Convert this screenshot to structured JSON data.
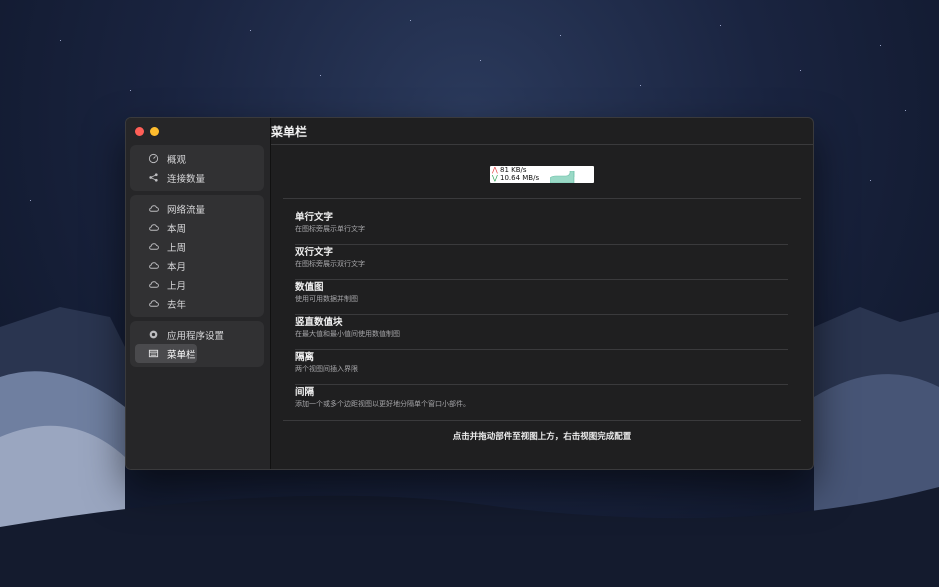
{
  "window": {
    "title": "菜单栏"
  },
  "sidebar": {
    "groups": [
      {
        "items": [
          {
            "label": "概观",
            "icon": "gauge-icon"
          },
          {
            "label": "连接数量",
            "icon": "share-icon"
          }
        ]
      },
      {
        "items": [
          {
            "label": "网络流量",
            "icon": "cloud-icon"
          },
          {
            "label": "本周",
            "icon": "cloud-icon"
          },
          {
            "label": "上周",
            "icon": "cloud-icon"
          },
          {
            "label": "本月",
            "icon": "cloud-icon"
          },
          {
            "label": "上月",
            "icon": "cloud-icon"
          },
          {
            "label": "去年",
            "icon": "cloud-icon"
          }
        ]
      },
      {
        "items": [
          {
            "label": "应用程序设置",
            "icon": "gear-icon"
          },
          {
            "label": "菜单栏",
            "icon": "menubar-icon",
            "selected": true
          }
        ]
      }
    ]
  },
  "preview": {
    "upload": "81 KB/s",
    "download": "10.64 MB/s"
  },
  "widgets": [
    {
      "title": "单行文字",
      "desc": "在图标旁展示单行文字"
    },
    {
      "title": "双行文字",
      "desc": "在图标旁展示双行文字"
    },
    {
      "title": "数值图",
      "desc": "使用可用数据并制图"
    },
    {
      "title": "竖直数值块",
      "desc": "在最大值和最小值间使用数值制图"
    },
    {
      "title": "隔离",
      "desc": "两个视图间插入界限"
    },
    {
      "title": "间隔",
      "desc": "添加一个或多个边距视图以更好地分隔单个窗口小部件。"
    }
  ],
  "hint": "点击并拖动部件至视图上方，右击视图完成配置",
  "colors": {
    "close": "#ff5f57",
    "minimize": "#febc2e",
    "upload_arrow": "#e23b3b",
    "download_arrow": "#2a9c4e",
    "graph_fill": "#9ad9c6"
  }
}
